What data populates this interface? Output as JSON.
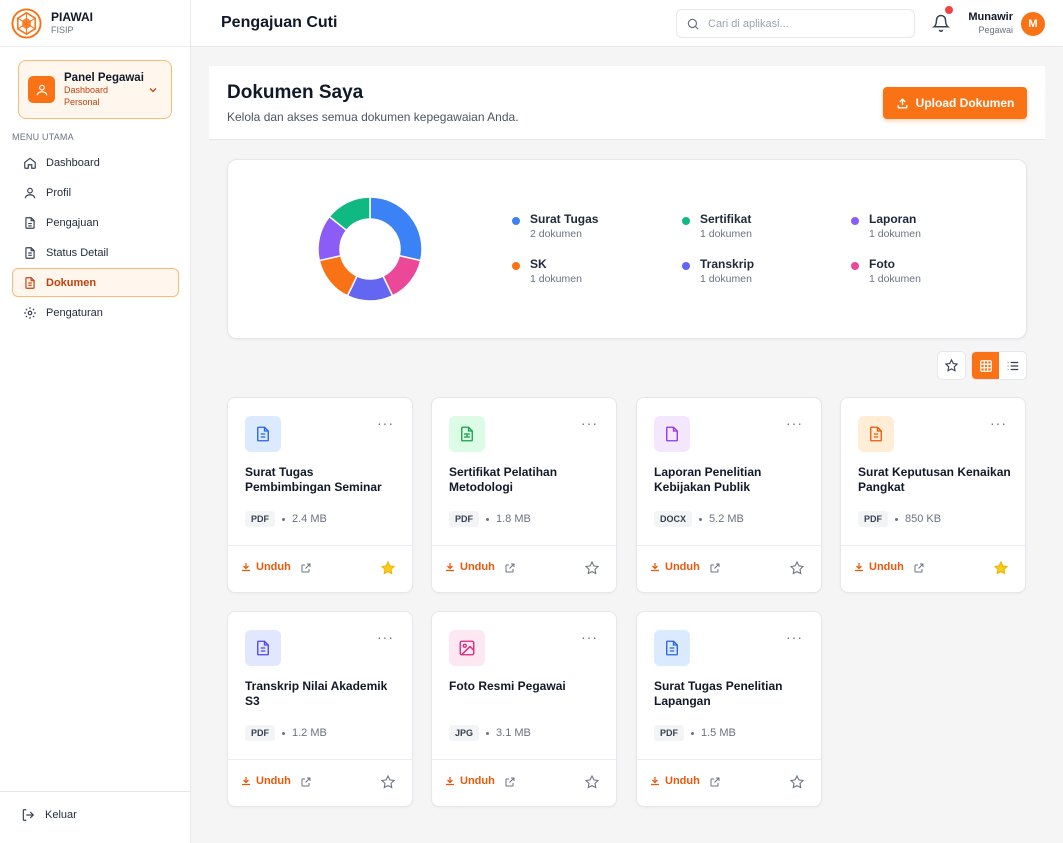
{
  "brand": {
    "name": "PIAWAI",
    "sub": "FISIP"
  },
  "panel": {
    "title": "Panel Pegawai",
    "subtitle": "Dashboard\nPersonal"
  },
  "menu": {
    "heading": "MENU UTAMA",
    "items": [
      {
        "label": "Dashboard",
        "icon": "home-icon"
      },
      {
        "label": "Profil",
        "icon": "user-icon"
      },
      {
        "label": "Pengajuan",
        "icon": "file-icon"
      },
      {
        "label": "Status Detail",
        "icon": "file-text-icon"
      },
      {
        "label": "Dokumen",
        "icon": "document-icon",
        "active": true
      },
      {
        "label": "Pengaturan",
        "icon": "gear-icon"
      }
    ],
    "logout": "Keluar"
  },
  "topbar": {
    "title": "Pengajuan Cuti",
    "search_placeholder": "Cari di aplikasi...",
    "user_name": "Munawir",
    "user_role": "Pegawai",
    "avatar_letter": "M"
  },
  "header": {
    "title": "Dokumen Saya",
    "subtitle": "Kelola dan akses semua dokumen kepegawaian Anda.",
    "upload_label": "Upload Dokumen"
  },
  "stats": [
    {
      "name": "Surat Tugas",
      "count": "2 dokumen",
      "color": "#3b82f6"
    },
    {
      "name": "Sertifikat",
      "count": "1 dokumen",
      "color": "#10b981"
    },
    {
      "name": "Laporan",
      "count": "1 dokumen",
      "color": "#8b5cf6"
    },
    {
      "name": "SK",
      "count": "1 dokumen",
      "color": "#f97316"
    },
    {
      "name": "Transkrip",
      "count": "1 dokumen",
      "color": "#6366f1"
    },
    {
      "name": "Foto",
      "count": "1 dokumen",
      "color": "#ec4899"
    }
  ],
  "chart_data": {
    "type": "pie",
    "categories": [
      "Surat Tugas",
      "Foto",
      "Transkrip",
      "SK",
      "Laporan",
      "Sertifikat"
    ],
    "values": [
      2,
      1,
      1,
      1,
      1,
      1
    ],
    "colors": [
      "#3b82f6",
      "#ec4899",
      "#6366f1",
      "#f97316",
      "#8b5cf6",
      "#10b981"
    ]
  },
  "documents": [
    {
      "title": "Surat Tugas Pembimbingan Seminar",
      "type": "PDF",
      "size": "2.4 MB",
      "starred": true,
      "icon_bg": "#dbeafe",
      "icon_color": "#2563eb",
      "icon": "file-text-icon"
    },
    {
      "title": "Sertifikat Pelatihan Metodologi",
      "type": "PDF",
      "size": "1.8 MB",
      "starred": false,
      "icon_bg": "#dcfce7",
      "icon_color": "#16a34a",
      "icon": "certificate-icon"
    },
    {
      "title": "Laporan Penelitian Kebijakan Publik",
      "type": "DOCX",
      "size": "5.2 MB",
      "starred": false,
      "icon_bg": "#f3e8ff",
      "icon_color": "#9333ea",
      "icon": "file-icon"
    },
    {
      "title": "Surat Keputusan Kenaikan Pangkat",
      "type": "PDF",
      "size": "850 KB",
      "starred": true,
      "icon_bg": "#ffedd5",
      "icon_color": "#ea580c",
      "icon": "file-text-icon"
    },
    {
      "title": "Transkrip Nilai Akademik S3",
      "type": "PDF",
      "size": "1.2 MB",
      "starred": false,
      "icon_bg": "#e0e7ff",
      "icon_color": "#4f46e5",
      "icon": "file-text-icon"
    },
    {
      "title": "Foto Resmi Pegawai",
      "type": "JPG",
      "size": "3.1 MB",
      "starred": false,
      "icon_bg": "#fce7f3",
      "icon_color": "#db2777",
      "icon": "image-icon"
    },
    {
      "title": "Surat Tugas Penelitian Lapangan",
      "type": "PDF",
      "size": "1.5 MB",
      "starred": false,
      "icon_bg": "#dbeafe",
      "icon_color": "#2563eb",
      "icon": "file-text-icon"
    }
  ],
  "card_labels": {
    "download": "Unduh",
    "more": "···"
  }
}
